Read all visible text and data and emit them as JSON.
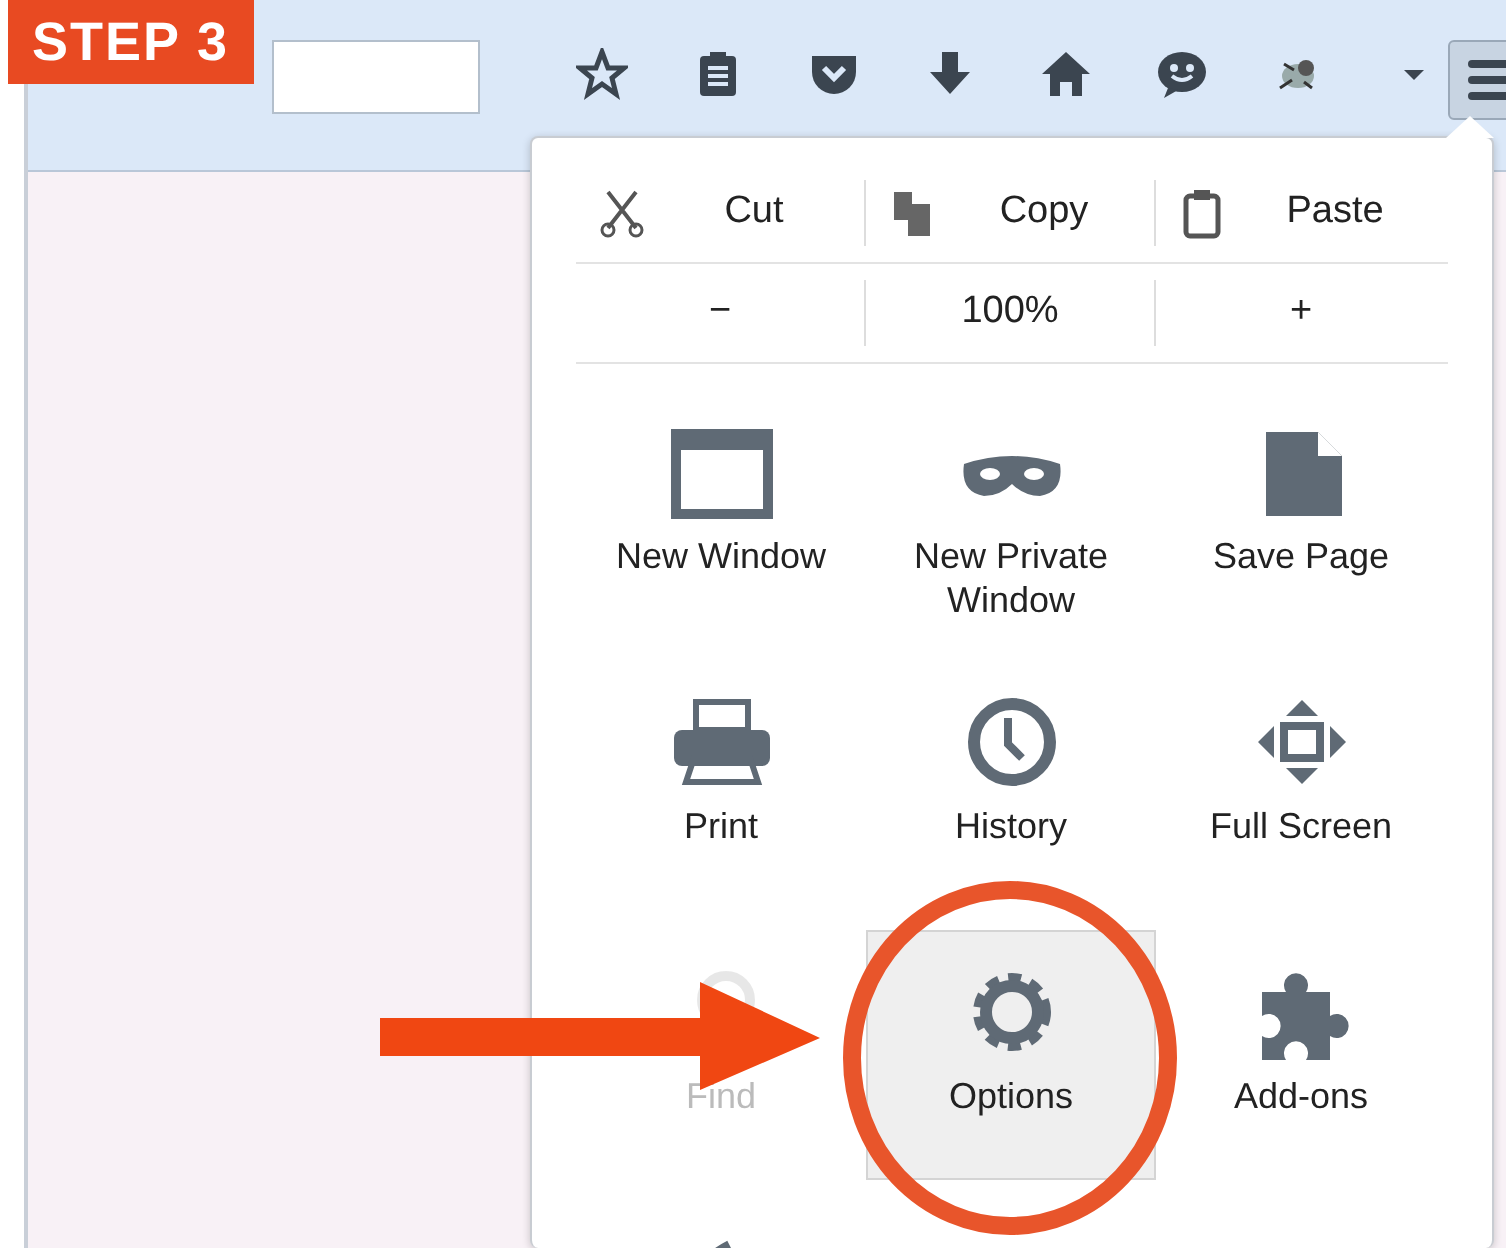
{
  "badge": "STEP 3",
  "toolbar": {
    "icons": [
      {
        "kind": "star"
      },
      {
        "kind": "reading-list"
      },
      {
        "kind": "pocket"
      },
      {
        "kind": "download"
      },
      {
        "kind": "home"
      },
      {
        "kind": "chat"
      },
      {
        "kind": "bug"
      },
      {
        "kind": "dropdown"
      }
    ],
    "menu_button_pressed": true
  },
  "menu": {
    "edit_row": [
      {
        "kind": "cut",
        "label": "Cut"
      },
      {
        "kind": "copy",
        "label": "Copy"
      },
      {
        "kind": "paste",
        "label": "Paste"
      }
    ],
    "zoom_row": [
      "−",
      "100%",
      "+"
    ],
    "items": [
      {
        "kind": "window",
        "label": "New Window",
        "selected": false,
        "disabled": false
      },
      {
        "kind": "mask",
        "label": "New Private Window",
        "selected": false,
        "disabled": false
      },
      {
        "kind": "page",
        "label": "Save Page",
        "selected": false,
        "disabled": false
      },
      {
        "kind": "printer",
        "label": "Print",
        "selected": false,
        "disabled": false
      },
      {
        "kind": "clock",
        "label": "History",
        "selected": false,
        "disabled": false
      },
      {
        "kind": "fullscreen",
        "label": "Full Screen",
        "selected": false,
        "disabled": false
      },
      {
        "kind": "search",
        "label": "Find",
        "selected": false,
        "disabled": true
      },
      {
        "kind": "gear",
        "label": "Options",
        "selected": true,
        "disabled": false
      },
      {
        "kind": "puzzle",
        "label": "Add-ons",
        "selected": false,
        "disabled": false
      },
      {
        "kind": "brush",
        "selected": false,
        "disabled": false
      }
    ]
  }
}
